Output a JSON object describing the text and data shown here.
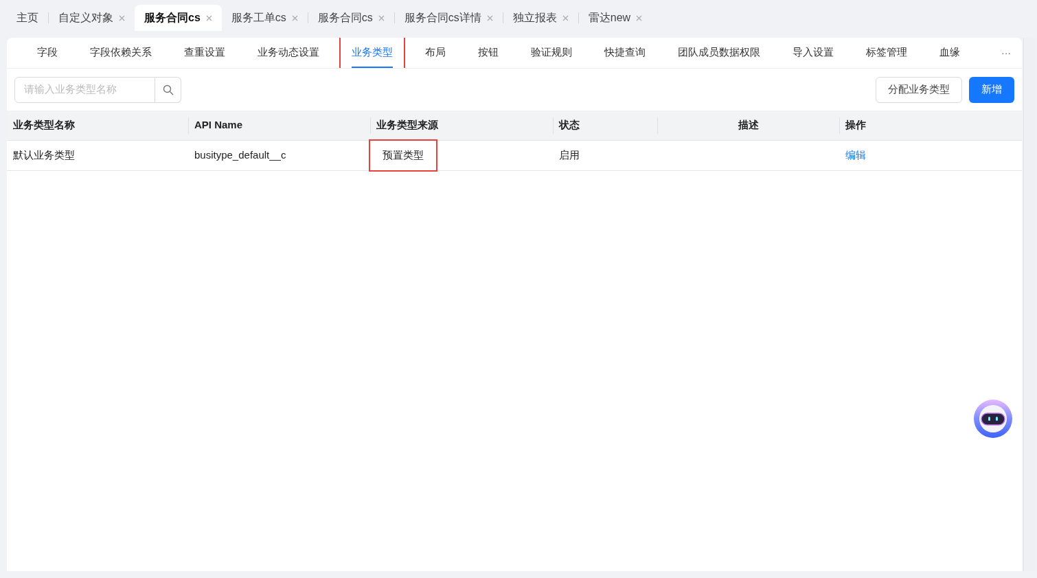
{
  "top_tabs": [
    {
      "label": "主页",
      "selected": false,
      "closable": false
    },
    {
      "label": "自定义对象",
      "selected": false,
      "closable": true
    },
    {
      "label": "服务合同cs",
      "selected": true,
      "closable": true
    },
    {
      "label": "服务工单cs",
      "selected": false,
      "closable": true
    },
    {
      "label": "服务合同cs",
      "selected": false,
      "closable": true
    },
    {
      "label": "服务合同cs详情",
      "selected": false,
      "closable": true
    },
    {
      "label": "独立报表",
      "selected": false,
      "closable": true
    },
    {
      "label": "雷达new",
      "selected": false,
      "closable": true
    }
  ],
  "sub_tabs": [
    {
      "label": "字段",
      "selected": false,
      "highlighted": false
    },
    {
      "label": "字段依赖关系",
      "selected": false,
      "highlighted": false
    },
    {
      "label": "查重设置",
      "selected": false,
      "highlighted": false
    },
    {
      "label": "业务动态设置",
      "selected": false,
      "highlighted": false
    },
    {
      "label": "业务类型",
      "selected": true,
      "highlighted": true
    },
    {
      "label": "布局",
      "selected": false,
      "highlighted": false
    },
    {
      "label": "按钮",
      "selected": false,
      "highlighted": false
    },
    {
      "label": "验证规则",
      "selected": false,
      "highlighted": false
    },
    {
      "label": "快捷查询",
      "selected": false,
      "highlighted": false
    },
    {
      "label": "团队成员数据权限",
      "selected": false,
      "highlighted": false
    },
    {
      "label": "导入设置",
      "selected": false,
      "highlighted": false
    },
    {
      "label": "标签管理",
      "selected": false,
      "highlighted": false
    },
    {
      "label": "血缘",
      "selected": false,
      "highlighted": false
    }
  ],
  "more_label": "···",
  "search": {
    "placeholder": "请输入业务类型名称"
  },
  "buttons": [
    {
      "label": "分配业务类型",
      "kind": "secondary"
    },
    {
      "label": "新增",
      "kind": "primary"
    }
  ],
  "table": {
    "columns": [
      "业务类型名称",
      "API Name",
      "业务类型来源",
      "状态",
      "描述",
      "操作"
    ],
    "rows": [
      {
        "name": "默认业务类型",
        "api_name": "busitype_default__c",
        "source": "预置类型",
        "source_highlighted": true,
        "status": "启用",
        "action": "编辑"
      }
    ]
  }
}
